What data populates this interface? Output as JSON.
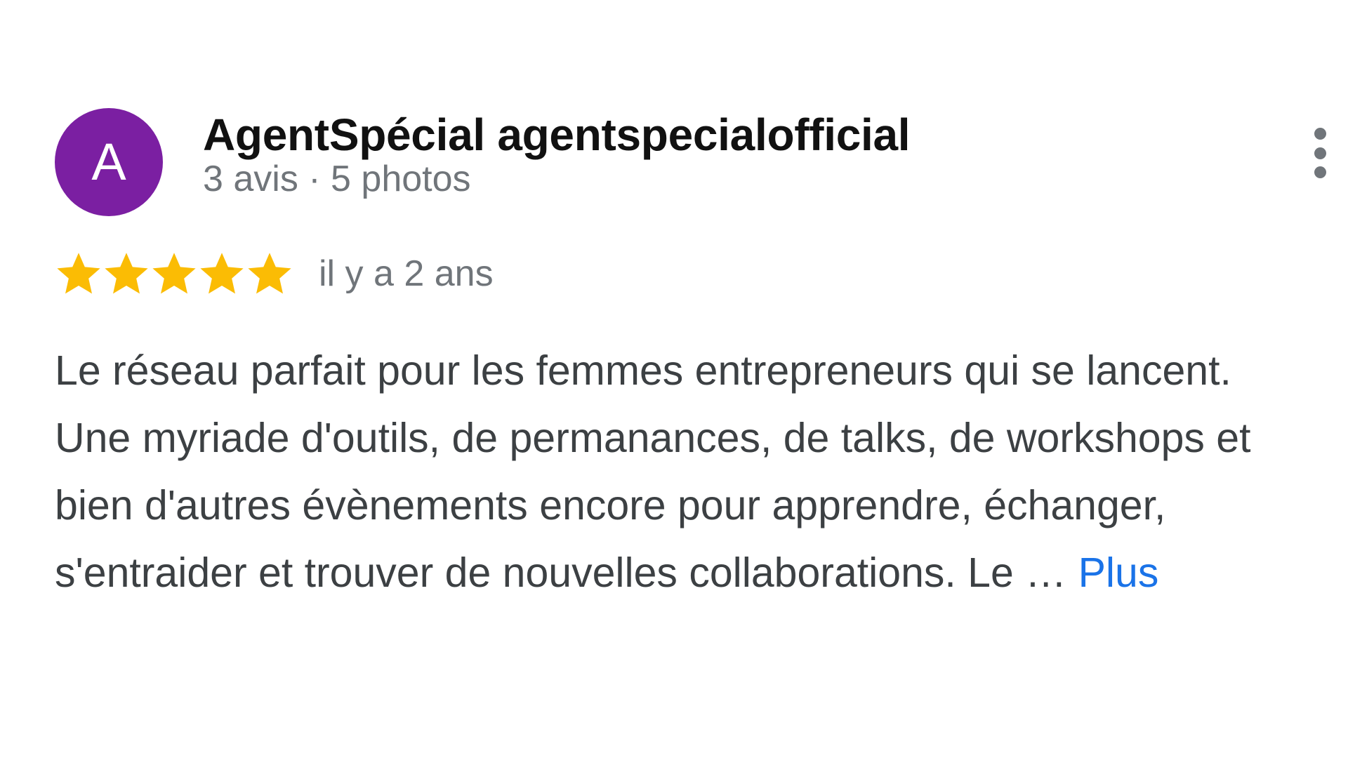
{
  "review": {
    "avatar_letter": "A",
    "avatar_color": "#7b1fa2",
    "author_name": "AgentSpécial agentspecialofficial",
    "author_meta": "3 avis · 5 photos",
    "rating": 5,
    "rating_max": 5,
    "star_color": "#fbbc04",
    "date": "il y a 2 ans",
    "text": "Le réseau parfait pour les femmes entrepreneurs qui se lancent. Une myriade d'outils, de permanances, de talks, de workshops et bien d'autres évènements encore pour apprendre, échanger, s'entraider et trouver de nouvelles collaborations. Le … ",
    "more_label": "Plus",
    "link_color": "#1a73e8"
  },
  "icons": {
    "menu": "more-vert-icon",
    "star": "star-icon"
  }
}
